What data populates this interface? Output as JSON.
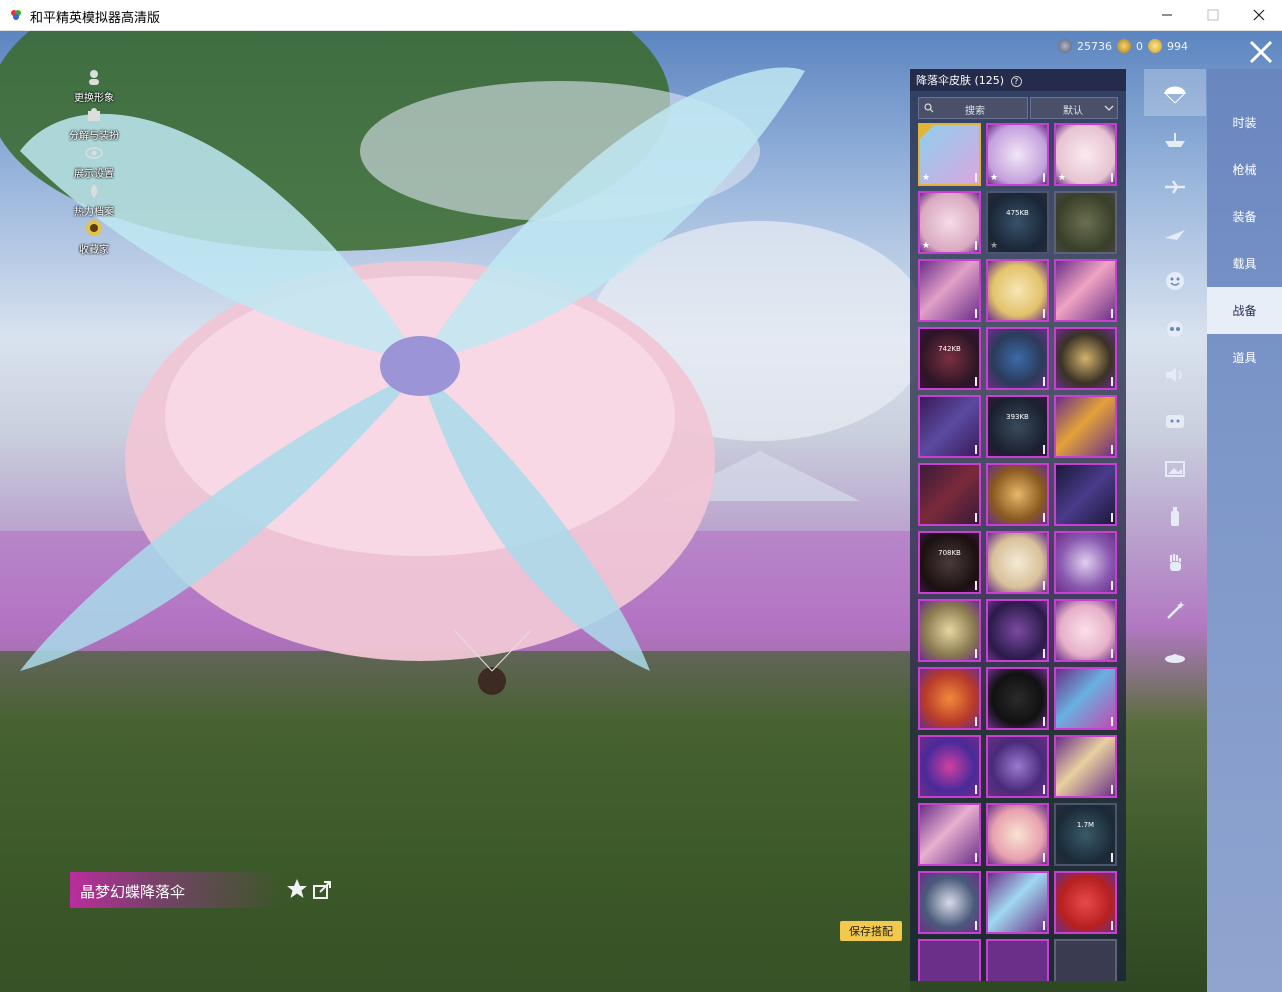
{
  "window": {
    "title": "和平精英模拟器高清版",
    "minimize_label": "—",
    "maximize_label": "☐",
    "close_label": "✕"
  },
  "left_menu": [
    {
      "label": "更换形象",
      "icon": "person-icon"
    },
    {
      "label": "分解与装扮",
      "icon": "puzzle-icon"
    },
    {
      "label": "展示设置",
      "icon": "eye-icon"
    },
    {
      "label": "热力档案",
      "icon": "flame-icon"
    },
    {
      "label": "收藏家",
      "icon": "trophy-icon"
    }
  ],
  "currency": {
    "amount1": "25736",
    "amount2": "0",
    "amount3": "994"
  },
  "panel": {
    "title": "降落伞皮肤 (125)",
    "help_icon": "?",
    "search_placeholder": "搜索",
    "sort_label": "默认",
    "sizes": {
      "dl1": "475KB",
      "dl2": "742KB",
      "dl3": "393KB",
      "dl4": "708KB",
      "dl5": "1.7M"
    }
  },
  "categories": [
    "parachute-icon",
    "boat-icon",
    "plane-icon",
    "glider-icon",
    "emote-icon",
    "robot-icon",
    "speaker-icon",
    "chat-icon",
    "photo-icon",
    "extinguisher-icon",
    "hand-icon",
    "wand-icon",
    "ufo-icon"
  ],
  "tabs": [
    "时装",
    "枪械",
    "装备",
    "载具",
    "战备",
    "道具"
  ],
  "active_tab": "战备",
  "selected_item": {
    "name": "晶梦幻蝶降落伞"
  },
  "save_button": "保存搭配",
  "colors": {
    "accent_magenta": "#c93fd0",
    "tab_active_bg": "#e8eef8",
    "save_yellow": "#f2c94c"
  }
}
